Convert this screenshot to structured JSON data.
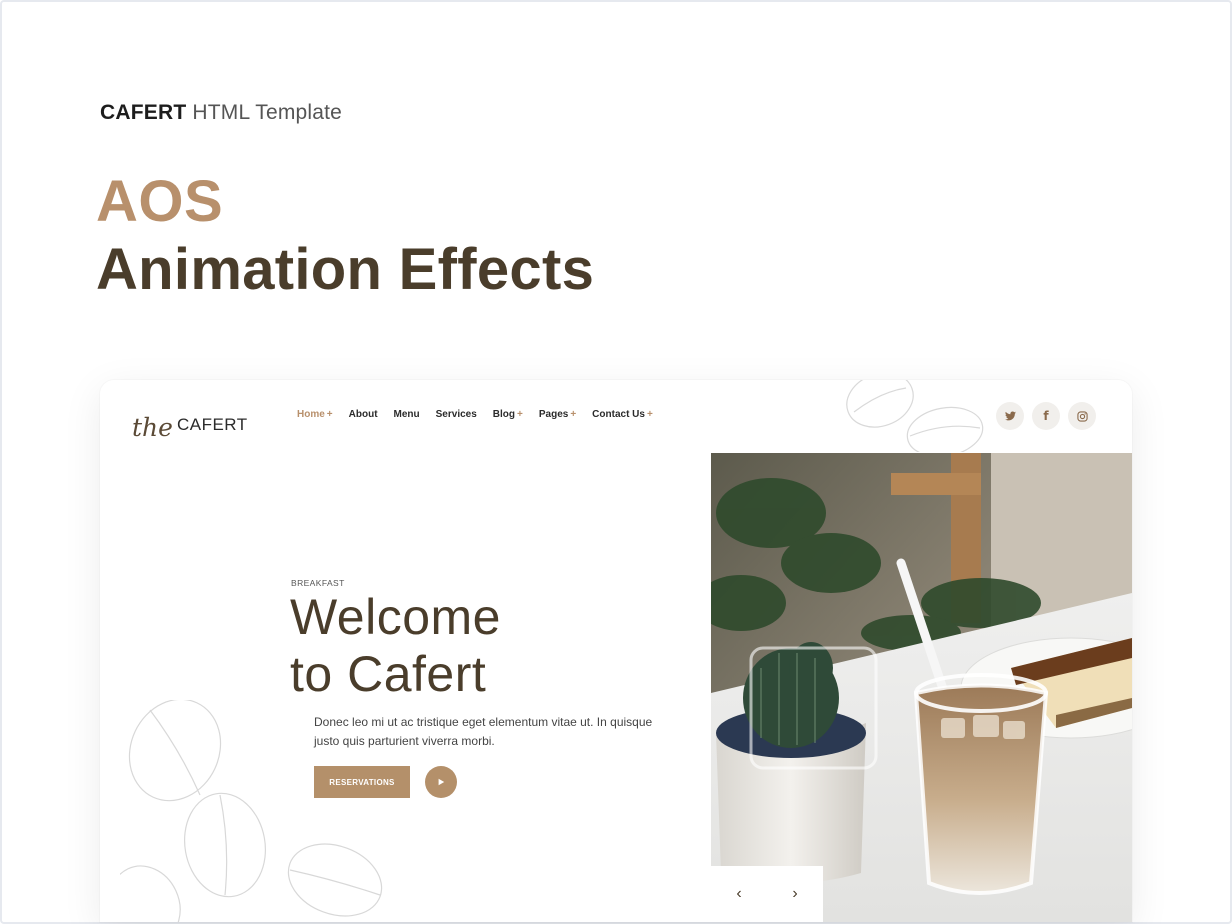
{
  "page": {
    "brand_bold": "CAFERT",
    "brand_rest": "HTML Template",
    "heading_line1": "AOS",
    "heading_line2": "Animation Effects"
  },
  "preview": {
    "logo": {
      "script": "the",
      "name": "CAFERT"
    },
    "nav": [
      {
        "label": "Home",
        "dropdown": true,
        "active": true
      },
      {
        "label": "About",
        "dropdown": false
      },
      {
        "label": "Menu",
        "dropdown": false
      },
      {
        "label": "Services",
        "dropdown": false
      },
      {
        "label": "Blog",
        "dropdown": true
      },
      {
        "label": "Pages",
        "dropdown": true
      },
      {
        "label": "Contact Us",
        "dropdown": true
      }
    ],
    "socials": [
      {
        "icon": "twitter-icon",
        "glyph": "🐦"
      },
      {
        "icon": "facebook-icon",
        "glyph": "f"
      },
      {
        "icon": "instagram-icon",
        "glyph": "◎"
      }
    ],
    "hero": {
      "eyebrow": "BREAKFAST",
      "title_line1": "Welcome",
      "title_line2": "to Cafert",
      "description": "Donec leo mi ut ac tristique eget elementum vitae ut. In quisque justo quis parturient viverra morbi.",
      "reservations_label": "RESERVATIONS",
      "play_icon": "play-icon"
    },
    "slider": {
      "prev_icon": "chevron-left-icon",
      "next_icon": "chevron-right-icon",
      "prev": "‹",
      "next": "›"
    }
  },
  "colors": {
    "accent": "#b8906c",
    "dark_brown": "#4a3d2b",
    "button": "#b4906a"
  }
}
